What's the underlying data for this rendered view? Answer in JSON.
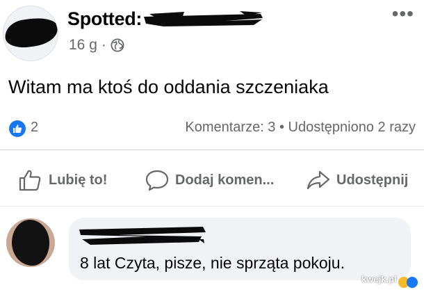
{
  "post": {
    "group_name": "Spotted:",
    "time": "16 g",
    "separator": "·",
    "privacy_icon": "globe-icon",
    "more_label": "•••",
    "text": "Witam ma ktoś do oddania szczeniaka",
    "reactions": {
      "icon": "like-icon",
      "count": "2"
    },
    "engagement": "Komentarze: 3 • Udostępniono 2 razy"
  },
  "actions": {
    "like": "Lubię to!",
    "comment": "Dodaj komen...",
    "share": "Udostępnij"
  },
  "comment": {
    "text": "8 lat Czyta, pisze, nie sprząta pokoju."
  },
  "watermark": "kwejk.pl",
  "colors": {
    "text": "#050505",
    "muted": "#65676b",
    "accent": "#1877f2",
    "bubble": "#f0f2f5",
    "divider": "#ced0d4"
  }
}
